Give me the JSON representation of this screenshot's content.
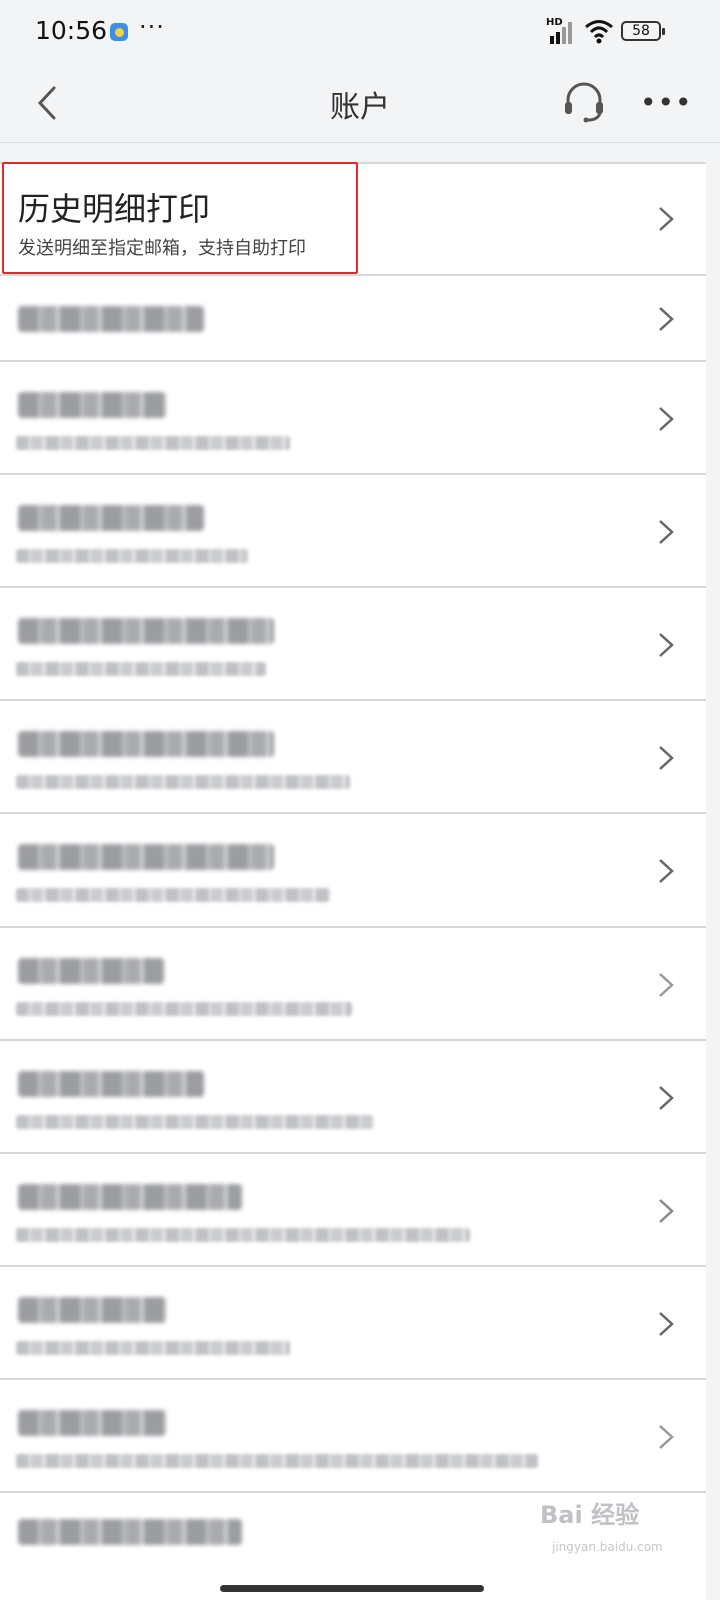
{
  "status_bar": {
    "time": "10:56",
    "network": "HD",
    "battery": "58"
  },
  "nav": {
    "title": "账户"
  },
  "list": {
    "highlighted": {
      "title": "历史明细打印",
      "subtitle": "发送明细至指定邮箱，支持自助打印"
    }
  },
  "watermark": {
    "text": "Bai 经验",
    "url": "jingyan.baidu.com"
  },
  "colors": {
    "highlight_border": "#e02a2a",
    "background": "#f3f4f6",
    "row_bg": "#ffffff"
  }
}
